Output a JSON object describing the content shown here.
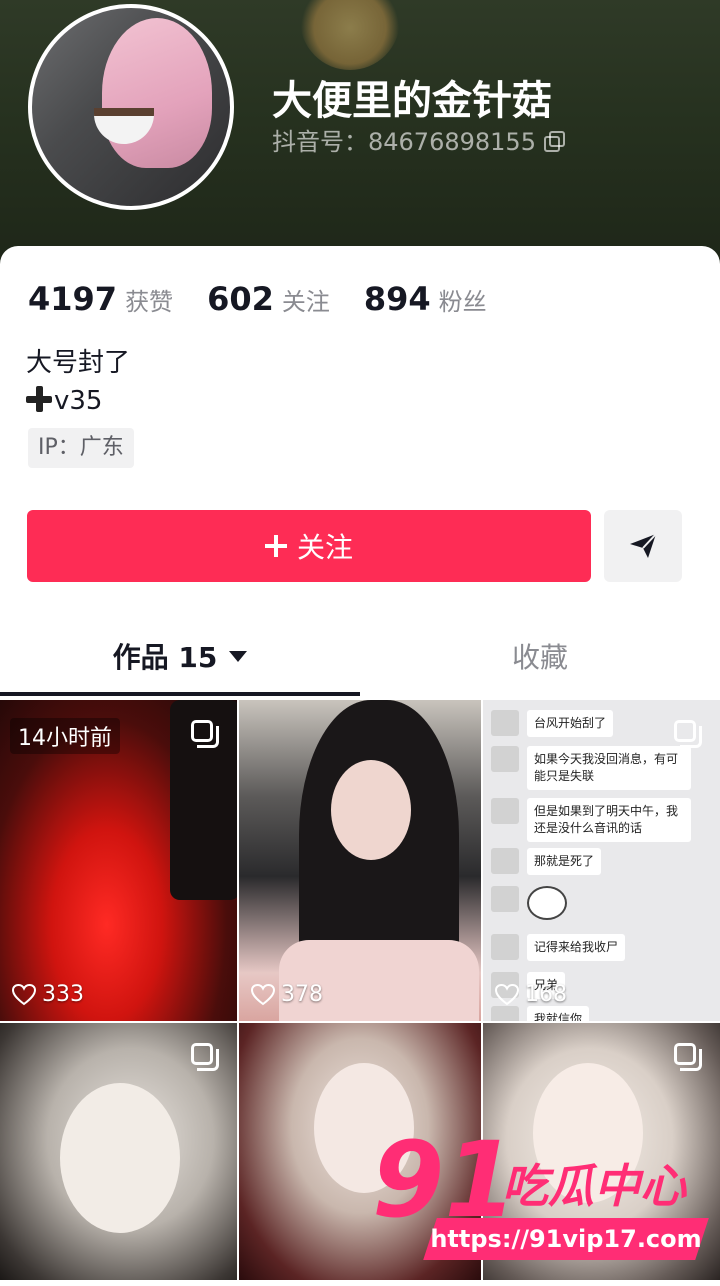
{
  "profile": {
    "nickname": "大便里的金针菇",
    "douyin_id": "抖音号：84676898155",
    "stats": [
      {
        "value": "4197",
        "label": "获赞"
      },
      {
        "value": "602",
        "label": "关注"
      },
      {
        "value": "894",
        "label": "粉丝"
      }
    ],
    "bio_line1": "大号封了",
    "bio_line2": "v35",
    "ip": "IP：广东"
  },
  "actions": {
    "follow_label": "关注",
    "accent_color": "#fe2c55"
  },
  "tabs": {
    "works_label": "作品 15",
    "collect_label": "收藏"
  },
  "videos": [
    {
      "time": "14小时前",
      "likes": "333"
    },
    {
      "likes": "378"
    },
    {
      "likes": "168"
    },
    {},
    {},
    {}
  ],
  "chat": [
    "台风开始刮了",
    "如果今天我没回消息，有可能只是失联",
    "但是如果到了明天中午，我还是没什么音讯的话",
    "那就是死了",
    "记得来给我收尸",
    "兄弟",
    "我就信你"
  ],
  "watermark": {
    "logo_number": "91",
    "logo_text": "吃瓜中心",
    "url": "https://91vip17.com"
  }
}
